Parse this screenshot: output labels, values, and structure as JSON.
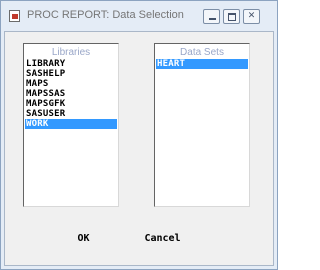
{
  "window": {
    "title": "PROC REPORT: Data Selection"
  },
  "icons": {
    "app": "sas-app-icon",
    "minimize": "minimize-icon",
    "maximize": "maximize-icon",
    "close": "close-icon"
  },
  "libraries": {
    "label": "Libraries",
    "items": [
      "LIBRARY",
      "SASHELP",
      "MAPS",
      "MAPSSAS",
      "MAPSGFK",
      "SASUSER",
      "WORK"
    ],
    "selected": "WORK"
  },
  "datasets": {
    "label": "Data Sets",
    "items": [
      "HEART"
    ],
    "selected": "HEART"
  },
  "buttons": {
    "ok": "OK",
    "cancel": "Cancel"
  },
  "colors": {
    "selection": "#3399ff",
    "frame": "#e4ecf6"
  }
}
